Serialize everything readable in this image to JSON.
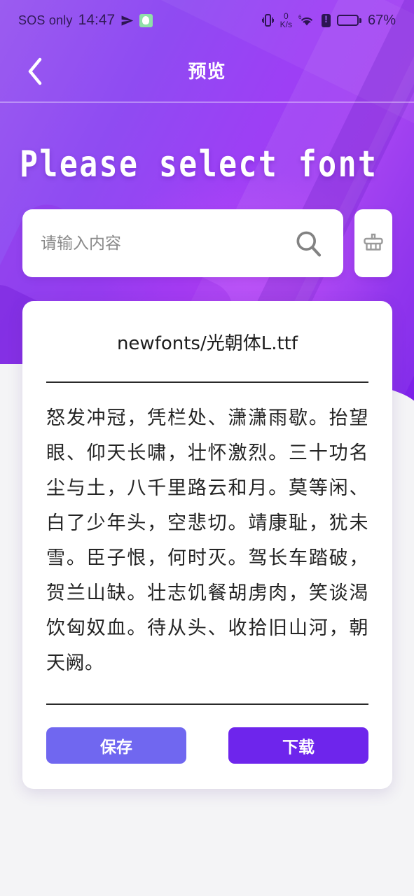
{
  "status_bar": {
    "carrier": "SOS only",
    "clock": "14:47",
    "net_speed_value": "0",
    "net_speed_unit": "K/s",
    "wifi_generation": "6",
    "battery_percent": "67%",
    "icons": [
      "send-icon",
      "app-chip-icon",
      "vibrate-icon",
      "wifi-icon",
      "sim-card-alert-icon",
      "battery-icon"
    ]
  },
  "nav": {
    "back_icon": "chevron-left-icon",
    "title": "预览"
  },
  "hero": {
    "heading": "Please select font",
    "gradient_from": "#9b5cf0",
    "gradient_to": "#7a1fe8"
  },
  "search": {
    "placeholder": "请输入内容",
    "value": "",
    "search_icon": "search-icon",
    "clear_icon": "broom-icon"
  },
  "card": {
    "title": "newfonts/光朝体L.ttf",
    "preview_text": "怒发冲冠，凭栏处、潇潇雨歇。抬望眼、仰天长啸，壮怀激烈。三十功名尘与土，八千里路云和月。莫等闲、白了少年头，空悲切。靖康耻，犹未雪。臣子恨，何时灭。驾长车踏破，贺兰山缺。壮志饥餐胡虏肉，笑谈渴饮匈奴血。待从头、收拾旧山河，朝天阙。",
    "buttons": {
      "save": {
        "label": "保存",
        "color": "#7067f0"
      },
      "download": {
        "label": "下载",
        "color": "#6e25ec"
      }
    }
  }
}
